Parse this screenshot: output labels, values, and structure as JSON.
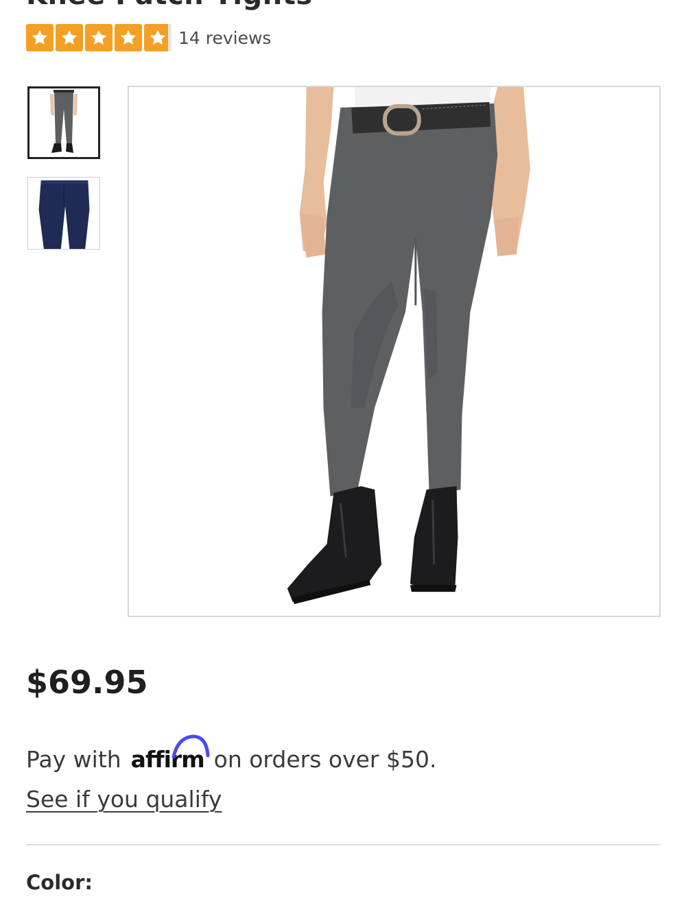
{
  "product": {
    "title": "Knee Patch Tights",
    "rating": 4.9,
    "rating_max": 5,
    "reviews_label": "14 reviews",
    "price": "$69.95"
  },
  "thumbnails": [
    {
      "icon": "gray-tights-front-image"
    },
    {
      "icon": "navy-tights-back-image"
    }
  ],
  "financing": {
    "prefix": "Pay with",
    "brand": "affirm",
    "suffix": "on orders over $50.",
    "link_label": "See if you qualify",
    "brand_accent": "#4a4af4"
  },
  "options": {
    "color_label": "Color:"
  },
  "colors": {
    "star": "#f4a025",
    "pants_gray": "#5e5f61",
    "pants_navy": "#1f2b55"
  }
}
